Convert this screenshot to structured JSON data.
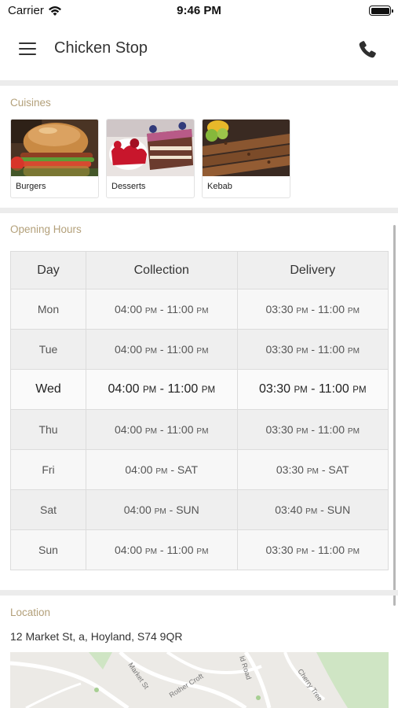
{
  "status": {
    "carrier": "Carrier",
    "time": "9:46 PM"
  },
  "header": {
    "title": "Chicken Stop"
  },
  "cuisines": {
    "title": "Cuisines",
    "items": [
      {
        "label": "Burgers"
      },
      {
        "label": "Desserts"
      },
      {
        "label": "Kebab"
      }
    ]
  },
  "hours": {
    "title": "Opening Hours",
    "columns": [
      "Day",
      "Collection",
      "Delivery"
    ],
    "rows": [
      {
        "day": "Mon",
        "collection": {
          "open": "04:00",
          "open_period": "PM",
          "sep": " - ",
          "close": "11:00",
          "close_period": "PM"
        },
        "delivery": {
          "open": "03:30",
          "open_period": "PM",
          "sep": " - ",
          "close": "11:00",
          "close_period": "PM"
        }
      },
      {
        "day": "Tue",
        "collection": {
          "open": "04:00",
          "open_period": "PM",
          "sep": " - ",
          "close": "11:00",
          "close_period": "PM"
        },
        "delivery": {
          "open": "03:30",
          "open_period": "PM",
          "sep": " - ",
          "close": "11:00",
          "close_period": "PM"
        }
      },
      {
        "day": "Wed",
        "collection": {
          "open": "04:00",
          "open_period": "PM",
          "sep": " - ",
          "close": "11:00",
          "close_period": "PM"
        },
        "delivery": {
          "open": "03:30",
          "open_period": "PM",
          "sep": " - ",
          "close": "11:00",
          "close_period": "PM"
        }
      },
      {
        "day": "Thu",
        "collection": {
          "open": "04:00",
          "open_period": "PM",
          "sep": " - ",
          "close": "11:00",
          "close_period": "PM"
        },
        "delivery": {
          "open": "03:30",
          "open_period": "PM",
          "sep": " - ",
          "close": "11:00",
          "close_period": "PM"
        }
      },
      {
        "day": "Fri",
        "collection": {
          "open": "04:00",
          "open_period": "PM",
          "sep": " - ",
          "close": "SAT",
          "close_period": ""
        },
        "delivery": {
          "open": "03:30",
          "open_period": "PM",
          "sep": " - ",
          "close": "SAT",
          "close_period": ""
        }
      },
      {
        "day": "Sat",
        "collection": {
          "open": "04:00",
          "open_period": "PM",
          "sep": " - ",
          "close": "SUN",
          "close_period": ""
        },
        "delivery": {
          "open": "03:40",
          "open_period": "PM",
          "sep": " - ",
          "close": "SUN",
          "close_period": ""
        }
      },
      {
        "day": "Sun",
        "collection": {
          "open": "04:00",
          "open_period": "PM",
          "sep": " - ",
          "close": "11:00",
          "close_period": "PM"
        },
        "delivery": {
          "open": "03:30",
          "open_period": "PM",
          "sep": " - ",
          "close": "11:00",
          "close_period": "PM"
        }
      }
    ]
  },
  "location": {
    "title": "Location",
    "address": "12 Market St, a, Hoyland, S74 9QR",
    "map_labels": [
      "Market St",
      "Rother Croft",
      "ld Road",
      "Cherry Tree"
    ]
  },
  "colors": {
    "section_title": "#b3a07a",
    "table_border": "#dcdcdc"
  },
  "icons": [
    "wifi-icon",
    "battery-icon",
    "menu-icon",
    "phone-icon"
  ]
}
